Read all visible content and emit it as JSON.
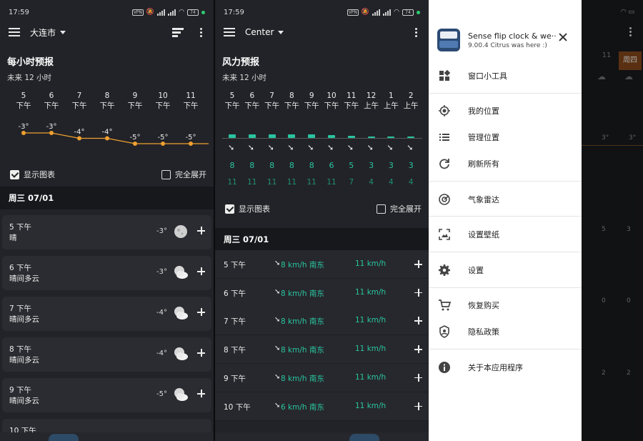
{
  "status": {
    "time": "17:59",
    "battery": "74",
    "net": "5G",
    "vpn": "VPN"
  },
  "panel1": {
    "location": "大连市",
    "title": "每小时预报",
    "subtitle": "未来 12 小时",
    "hours": [
      {
        "h": "5",
        "p": "下午",
        "temp": "-3°"
      },
      {
        "h": "6",
        "p": "下午",
        "temp": "-3°"
      },
      {
        "h": "7",
        "p": "下午",
        "temp": "-4°"
      },
      {
        "h": "8",
        "p": "下午",
        "temp": "-4°"
      },
      {
        "h": "9",
        "p": "下午",
        "temp": "-5°"
      },
      {
        "h": "10",
        "p": "下午",
        "temp": "-5°"
      },
      {
        "h": "11",
        "p": "下午",
        "temp": "-5°"
      }
    ],
    "show_chart": "显示图表",
    "expand_all": "完全展开",
    "day": "周三 07/01",
    "rows": [
      {
        "time": "5 下午",
        "cond": "晴",
        "temp": "-3°",
        "icon": "moon-icon"
      },
      {
        "time": "6 下午",
        "cond": "晴间多云",
        "temp": "-3°",
        "icon": "partly-cloudy-night-icon"
      },
      {
        "time": "7 下午",
        "cond": "晴间多云",
        "temp": "-4°",
        "icon": "partly-cloudy-night-icon"
      },
      {
        "time": "8 下午",
        "cond": "晴间多云",
        "temp": "-4°",
        "icon": "partly-cloudy-night-icon"
      },
      {
        "time": "9 下午",
        "cond": "晴间多云",
        "temp": "-5°",
        "icon": "partly-cloudy-night-icon"
      },
      {
        "time": "10 下午",
        "cond": "",
        "temp": "",
        "icon": ""
      }
    ]
  },
  "panel2": {
    "location": "Center",
    "title": "风力预报",
    "subtitle": "未来 12 小时",
    "hours": [
      {
        "h": "5",
        "p": "下午",
        "speed": "8",
        "gust": "11"
      },
      {
        "h": "6",
        "p": "下午",
        "speed": "8",
        "gust": "11"
      },
      {
        "h": "7",
        "p": "下午",
        "speed": "8",
        "gust": "11"
      },
      {
        "h": "8",
        "p": "下午",
        "speed": "8",
        "gust": "11"
      },
      {
        "h": "9",
        "p": "下午",
        "speed": "8",
        "gust": "11"
      },
      {
        "h": "10",
        "p": "下午",
        "speed": "6",
        "gust": "11"
      },
      {
        "h": "11",
        "p": "下午",
        "speed": "5",
        "gust": "7"
      },
      {
        "h": "12",
        "p": "上午",
        "speed": "3",
        "gust": "4"
      },
      {
        "h": "1",
        "p": "上午",
        "speed": "3",
        "gust": "4"
      },
      {
        "h": "2",
        "p": "上午",
        "speed": "3",
        "gust": "4"
      }
    ],
    "show_chart": "显示图表",
    "expand_all": "完全展开",
    "day": "周三 07/01",
    "rows": [
      {
        "time": "5 下午",
        "speed": "8 km/h 南东",
        "gust": "11 km/h"
      },
      {
        "time": "6 下午",
        "speed": "8 km/h 南东",
        "gust": "11 km/h"
      },
      {
        "time": "7 下午",
        "speed": "8 km/h 南东",
        "gust": "11 km/h"
      },
      {
        "time": "8 下午",
        "speed": "8 km/h 南东",
        "gust": "11 km/h"
      },
      {
        "time": "9 下午",
        "speed": "8 km/h 南东",
        "gust": "11 km/h"
      },
      {
        "time": "10 下午",
        "speed": "6 km/h 南东",
        "gust": "11 km/h"
      }
    ]
  },
  "drawer": {
    "app_name": "Sense flip clock & we··",
    "app_version": "9.00.4 Citrus was here :)",
    "items": [
      {
        "label": "窗口小工具",
        "icon": "widgets-icon"
      },
      {
        "label": "我的位置",
        "icon": "my-location-icon"
      },
      {
        "label": "管理位置",
        "icon": "list-icon"
      },
      {
        "label": "刷新所有",
        "icon": "refresh-icon"
      },
      {
        "label": "气象雷达",
        "icon": "radar-icon"
      },
      {
        "label": "设置壁纸",
        "icon": "wallpaper-icon"
      },
      {
        "label": "设置",
        "icon": "settings-icon"
      },
      {
        "label": "恢复购买",
        "icon": "cart-icon"
      },
      {
        "label": "隐私政策",
        "icon": "privacy-icon"
      },
      {
        "label": "关于本应用程序",
        "icon": "info-icon"
      }
    ]
  },
  "bgstrip": {
    "day_num": "11",
    "day_name": "周四",
    "temps": [
      "3°",
      "3°"
    ],
    "vals_a": [
      "5",
      "3"
    ],
    "vals_b": [
      "0",
      "0"
    ],
    "vals_c": [
      "2",
      "2"
    ]
  },
  "colors": {
    "accent_orange": "#f0a030",
    "teal": "#29c4a0",
    "bg": "#222328"
  }
}
